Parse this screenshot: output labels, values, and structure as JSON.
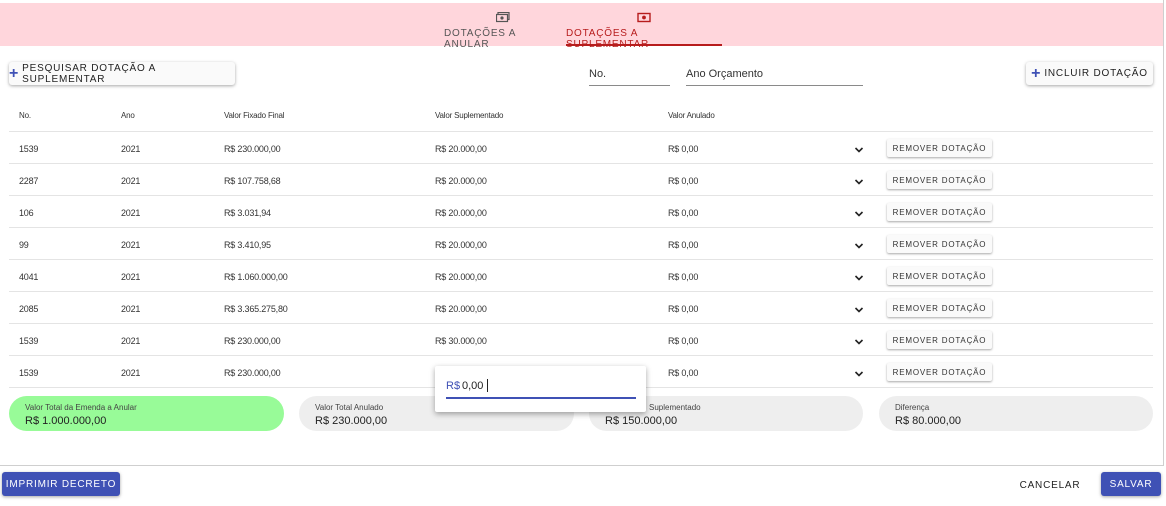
{
  "tabs": [
    {
      "label": "DOTAÇÕES A ANULAR",
      "icon": "money-icon",
      "active": false
    },
    {
      "label": "DOTAÇÕES A SUPLEMENTAR",
      "icon": "money-icon",
      "active": true
    }
  ],
  "toolbar": {
    "search_label": "PESQUISAR DOTAÇÃO A SUPLEMENTAR",
    "no_placeholder": "No.",
    "ano_placeholder": "Ano Orçamento",
    "include_label": "INCLUIR DOTAÇÃO"
  },
  "table": {
    "headers": [
      "No.",
      "Ano",
      "Valor Fixado Final",
      "Valor Suplementado",
      "Valor Anulado"
    ],
    "remove_label": "REMOVER DOTAÇÃO",
    "rows": [
      {
        "no": "1539",
        "ano": "2021",
        "fixado": "R$ 230.000,00",
        "suplementado": "R$ 20.000,00",
        "anulado": "R$ 0,00"
      },
      {
        "no": "2287",
        "ano": "2021",
        "fixado": "R$ 107.758,68",
        "suplementado": "R$ 20.000,00",
        "anulado": "R$ 0,00"
      },
      {
        "no": "106",
        "ano": "2021",
        "fixado": "R$ 3.031,94",
        "suplementado": "R$ 20.000,00",
        "anulado": "R$ 0,00"
      },
      {
        "no": "99",
        "ano": "2021",
        "fixado": "R$ 3.410,95",
        "suplementado": "R$ 20.000,00",
        "anulado": "R$ 0,00"
      },
      {
        "no": "4041",
        "ano": "2021",
        "fixado": "R$ 1.060.000,00",
        "suplementado": "R$ 20.000,00",
        "anulado": "R$ 0,00"
      },
      {
        "no": "2085",
        "ano": "2021",
        "fixado": "R$ 3.365.275,80",
        "suplementado": "R$ 20.000,00",
        "anulado": "R$ 0,00"
      },
      {
        "no": "1539",
        "ano": "2021",
        "fixado": "R$ 230.000,00",
        "suplementado": "R$ 30.000,00",
        "anulado": "R$ 0,00"
      },
      {
        "no": "1539",
        "ano": "2021",
        "fixado": "R$ 230.000,00",
        "suplementado": "",
        "anulado": "R$ 0,00"
      }
    ]
  },
  "popup": {
    "prefix": "R$",
    "value": "0,00"
  },
  "summary": [
    {
      "label": "Valor Total da Emenda a Anular",
      "value": "R$ 1.000.000,00",
      "color": "#98fb98"
    },
    {
      "label": "Valor Total Anulado",
      "value": "R$ 230.000,00",
      "color": "#eeeeee"
    },
    {
      "label": "Suplementado",
      "value": "R$ 150.000,00",
      "color": "#eeeeee"
    },
    {
      "label": "Diferença",
      "value": "R$ 80.000,00",
      "color": "#eeeeee"
    }
  ],
  "footer": {
    "print_label": "IMPRIMIR DECRETO",
    "cancel_label": "CANCELAR",
    "save_label": "SALVAR"
  },
  "colors": {
    "primary": "#3f51b5",
    "accent": "#b71c1c",
    "tab_bg": "#ffd6dc"
  }
}
